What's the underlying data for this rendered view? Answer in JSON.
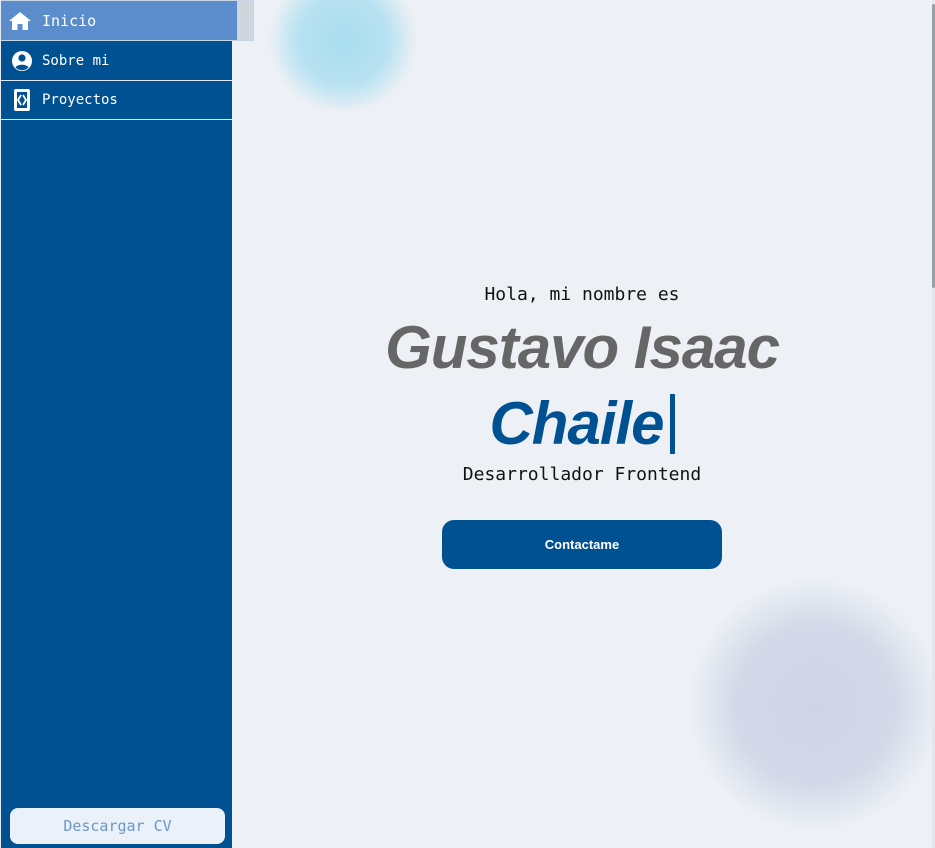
{
  "sidebar": {
    "items": [
      {
        "label": "Inicio",
        "icon": "home-icon",
        "active": true
      },
      {
        "label": "Sobre mi",
        "icon": "user-circle-icon",
        "active": false
      },
      {
        "label": "Proyectos",
        "icon": "code-file-icon",
        "active": false
      }
    ],
    "cv_button_label": "Descargar CV"
  },
  "hero": {
    "greeting": "Hola, mi nombre es",
    "name_line1": "Gustavo Isaac",
    "name_line2": "Chaile",
    "role": "Desarrollador Frontend",
    "contact_button_label": "Contactame"
  },
  "colors": {
    "primary": "#005192",
    "active_nav": "#5b8ccc",
    "background": "#edf1f6",
    "name_gray": "#666667"
  }
}
